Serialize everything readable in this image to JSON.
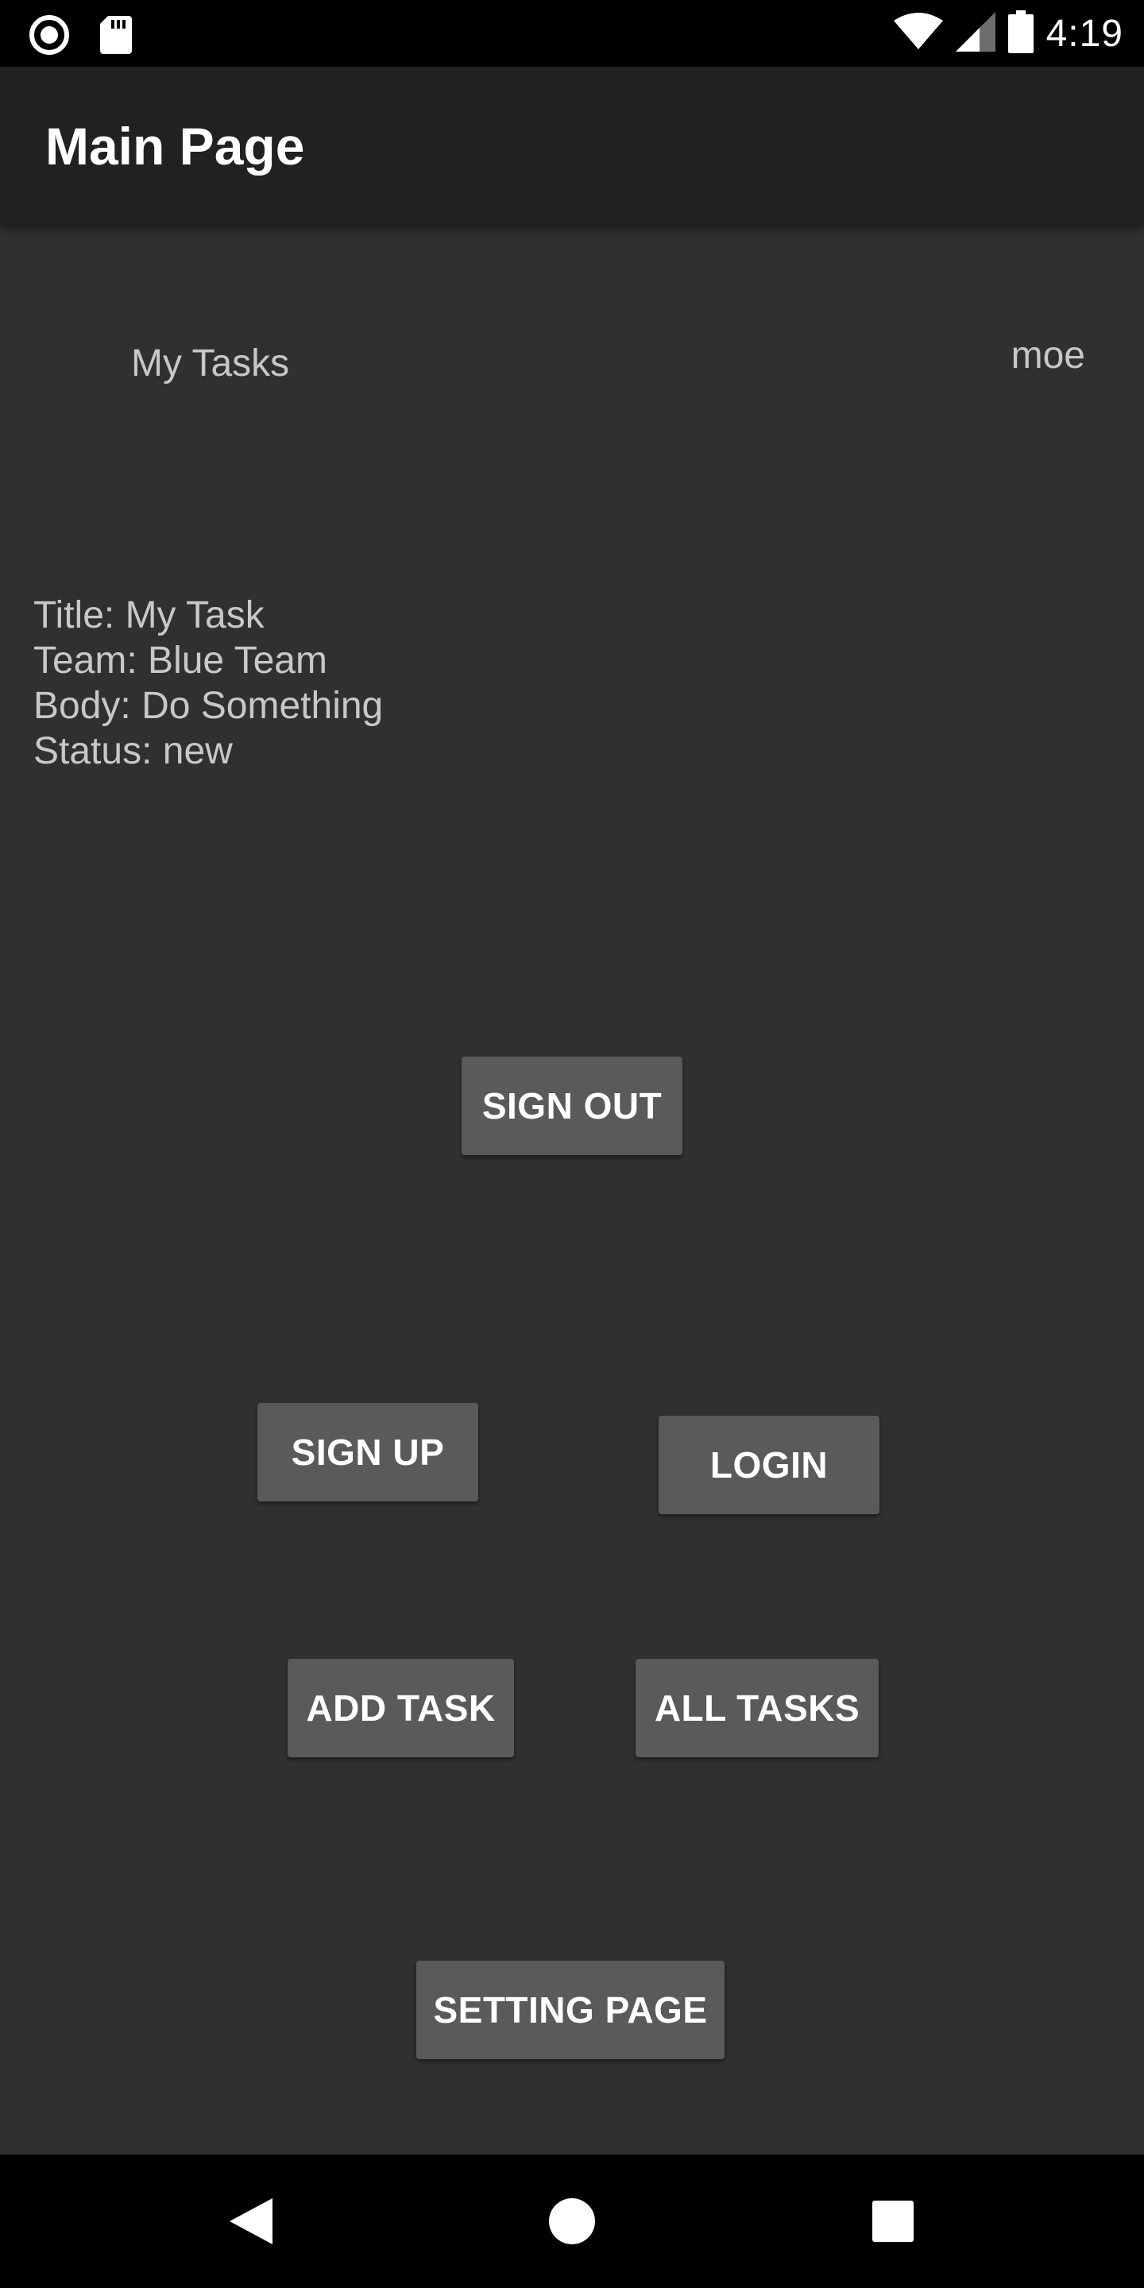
{
  "status_bar": {
    "time": "4:19",
    "icons_left": [
      "radio-button-icon",
      "sd-card-icon"
    ],
    "icons_right": [
      "wifi-icon",
      "cellular-signal-icon",
      "battery-icon"
    ]
  },
  "app_bar": {
    "title": "Main Page"
  },
  "main": {
    "section_label": "My Tasks",
    "username": "moe",
    "task": {
      "title_line": "Title: My Task",
      "team_line": "Team: Blue Team",
      "body_line": "Body: Do Something",
      "status_line": "Status: new"
    },
    "buttons": {
      "sign_out": "SIGN OUT",
      "sign_up": "SIGN UP",
      "login": "LOGIN",
      "add_task": "ADD TASK",
      "all_tasks": "ALL TASKS",
      "setting_page": "SETTING PAGE"
    }
  },
  "nav_bar": {
    "icons": [
      "back-icon",
      "home-icon",
      "recents-icon"
    ]
  },
  "colors": {
    "background": "#303030",
    "app_bar": "#212121",
    "button": "#5a5a5a",
    "text_secondary": "#c8c8c8",
    "system_bars": "#000000"
  }
}
